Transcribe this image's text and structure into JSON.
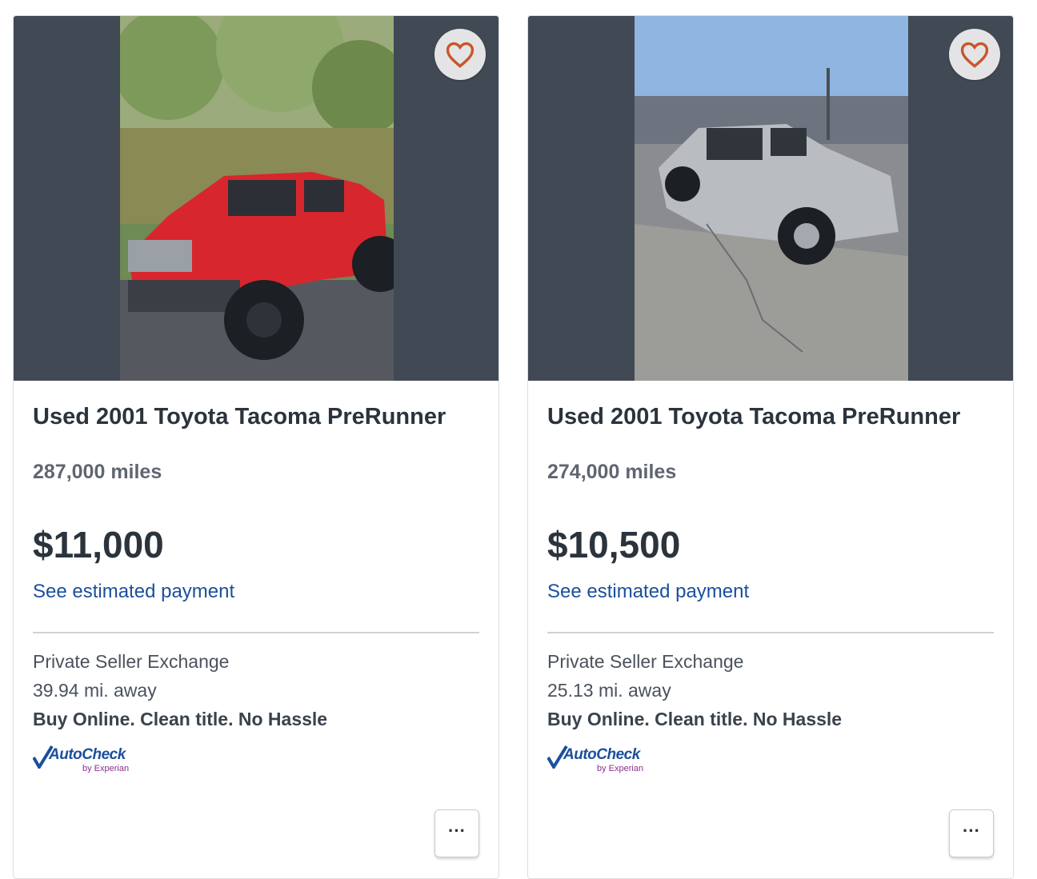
{
  "listings": [
    {
      "title": "Used 2001 Toyota Tacoma PreRunner",
      "miles": "287,000 miles",
      "price": "$11,000",
      "payment_link": "See estimated payment",
      "seller": "Private Seller Exchange",
      "distance": "39.94 mi. away",
      "tagline": "Buy Online. Clean title. No Hassle",
      "autocheck_name": "AutoCheck",
      "autocheck_by": "by Experian",
      "more_label": "···",
      "truck_color": "#d8262e"
    },
    {
      "title": "Used 2001 Toyota Tacoma PreRunner",
      "miles": "274,000 miles",
      "price": "$10,500",
      "payment_link": "See estimated payment",
      "seller": "Private Seller Exchange",
      "distance": "25.13 mi. away",
      "tagline": "Buy Online. Clean title. No Hassle",
      "autocheck_name": "AutoCheck",
      "autocheck_by": "by Experian",
      "more_label": "···",
      "truck_color": "#b9bdc2"
    }
  ],
  "colors": {
    "heart": "#c8562a",
    "link": "#1b4f9b",
    "photo_backdrop": "#414954"
  }
}
